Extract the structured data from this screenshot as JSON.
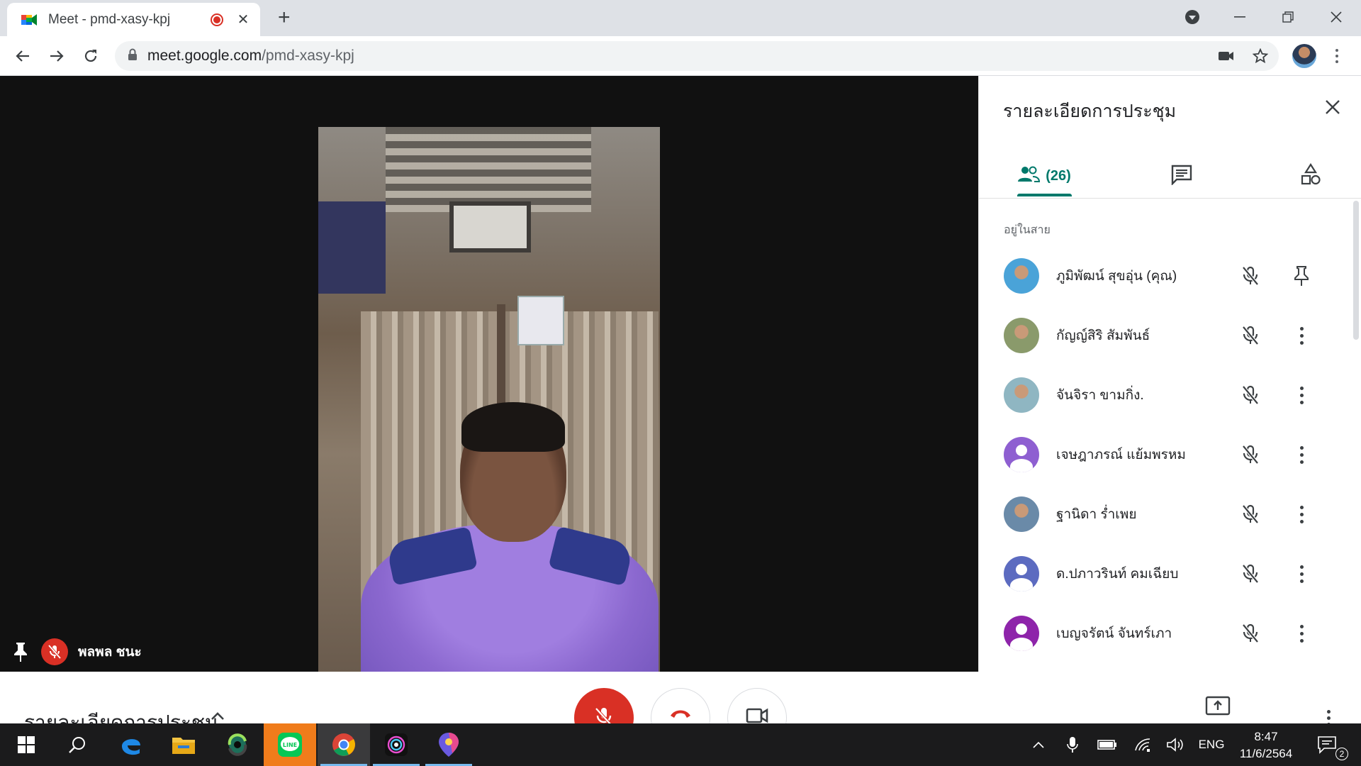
{
  "browser": {
    "tab_title": "Meet - pmd-xasy-kpj",
    "url_host": "meet.google.com",
    "url_path": "/pmd-xasy-kpj"
  },
  "stage": {
    "caption_name": "พลพล ชนะ"
  },
  "panel": {
    "title": "รายละเอียดการประชุม",
    "people_count": "(26)",
    "section_label": "อยู่ในสาย",
    "participants": [
      {
        "name": "ภูมิพัฒน์ สุขอุ่น (คุณ)",
        "avatar_color": "#4aa3d8",
        "action": "pin-icon"
      },
      {
        "name": "กัญญ์สิริ สัมพันธ์",
        "avatar_color": "#8a9a6b",
        "action": "more-icon"
      },
      {
        "name": "จันจิรา ขามกิ่ง.",
        "avatar_color": "#8fb6c2",
        "action": "more-icon"
      },
      {
        "name": "เจษฎาภรณ์ แย้มพรหม",
        "avatar_color": "#8e5fd1",
        "action": "more-icon"
      },
      {
        "name": "ฐานิดา ร่ำเพย",
        "avatar_color": "#6a8aa8",
        "action": "more-icon"
      },
      {
        "name": "ด.ปภาวรินท์ คมเฉียบ",
        "avatar_color": "#5c6bc0",
        "action": "more-icon"
      },
      {
        "name": "เบญจรัตน์ จันทร์เภา",
        "avatar_color": "#8e24aa",
        "action": "more-icon"
      }
    ]
  },
  "bottombar": {
    "meeting_details": "รายละเอียดการประชุม"
  },
  "taskbar": {
    "language": "ENG",
    "time": "8:47",
    "date": "11/6/2564",
    "notification_count": "2"
  },
  "colors": {
    "meet_accent": "#00796b",
    "danger": "#d93025"
  }
}
